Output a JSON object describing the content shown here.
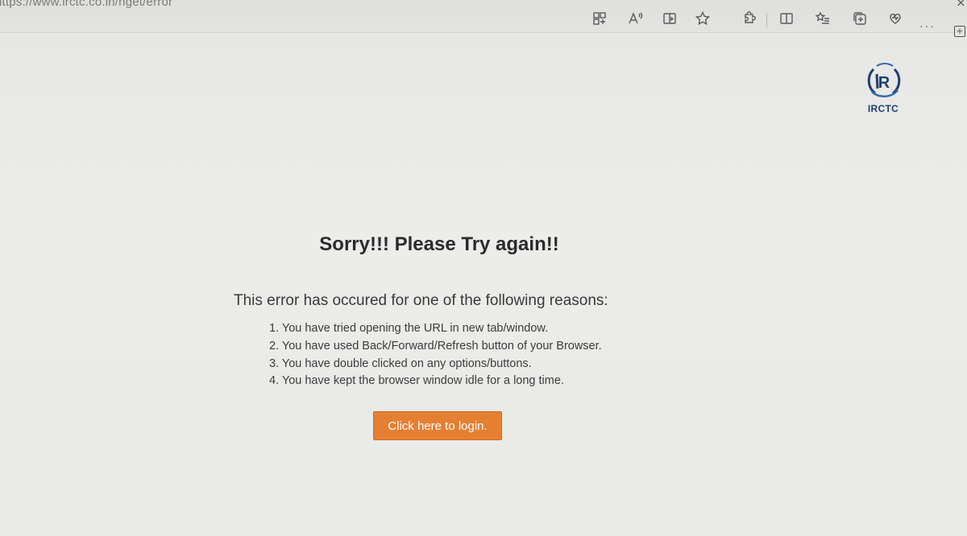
{
  "browser": {
    "url": "https://www.irctc.co.in/nget/error",
    "more_label": "···"
  },
  "logo": {
    "text": "IRCTC",
    "brand_color": "#1f3f6f"
  },
  "error": {
    "heading": "Sorry!!! Please Try again!!",
    "subheading": "This error has occured for one of the following reasons:",
    "reasons": [
      "1. You have tried opening the URL in new tab/window.",
      "2. You have used Back/Forward/Refresh button of your Browser.",
      "3. You have double clicked on any options/buttons.",
      "4. You have kept the browser window idle for a long time."
    ]
  },
  "login_button": {
    "label": "Click here to login.",
    "color": "#e57f32"
  }
}
